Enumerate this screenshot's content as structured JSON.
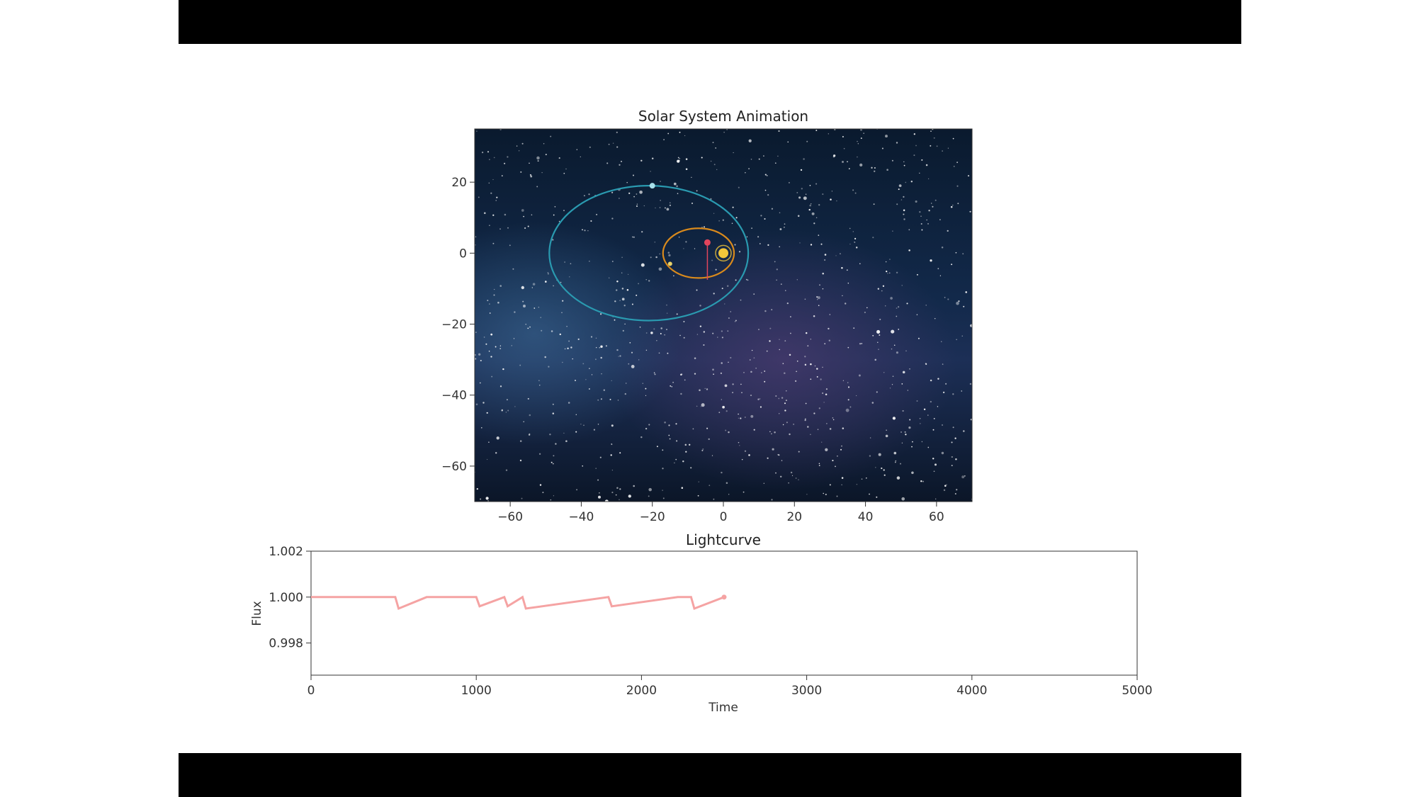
{
  "colors": {
    "letterbox": "#000000",
    "sky_top": "#0b1d33",
    "sky_band": "#3a2f5a",
    "outer_orbit": "#2a9ab0",
    "inner_orbit": "#d98a1c",
    "inner_planet": "#e0455c",
    "star": "#f2c63a",
    "flux_line": "#f5a3a3"
  },
  "chart_data": [
    {
      "type": "scatter",
      "title": "Solar System Animation",
      "xlim": [
        -70,
        70
      ],
      "ylim": [
        -70,
        35
      ],
      "x_ticks": [
        -60,
        -40,
        -20,
        0,
        20,
        40,
        60
      ],
      "x_tick_labels": [
        "−60",
        "−40",
        "−20",
        "0",
        "20",
        "40",
        "60"
      ],
      "y_ticks": [
        20,
        0,
        -20,
        -40,
        -60
      ],
      "y_tick_labels": [
        "20",
        "0",
        "−20",
        "−40",
        "−60"
      ],
      "background": "starfield image",
      "orbits": [
        {
          "center": [
            -21,
            0
          ],
          "semi_axes": [
            28,
            19
          ],
          "color": "outer_orbit"
        },
        {
          "center": [
            -7,
            0
          ],
          "semi_axes": [
            10,
            7
          ],
          "color": "inner_orbit"
        }
      ],
      "bodies": [
        {
          "x": 0,
          "y": 0,
          "kind": "star"
        },
        {
          "x": -20,
          "y": 19,
          "kind": "outer_planet"
        },
        {
          "x": -4.5,
          "y": 3,
          "kind": "inner_planet"
        },
        {
          "x": -15,
          "y": -3,
          "kind": "small_planet"
        }
      ]
    },
    {
      "type": "line",
      "title": "Lightcurve",
      "xlabel": "Time",
      "ylabel": "Flux",
      "xlim": [
        0,
        5000
      ],
      "ylim": [
        0.9966,
        1.002
      ],
      "x_ticks": [
        0,
        1000,
        2000,
        3000,
        4000,
        5000
      ],
      "x_tick_labels": [
        "0",
        "1000",
        "2000",
        "3000",
        "4000",
        "5000"
      ],
      "y_ticks": [
        1.002,
        1.0,
        0.998
      ],
      "y_tick_labels": [
        "1.002",
        "1.000",
        "0.998"
      ],
      "series": [
        {
          "x": [
            0,
            150,
            300,
            510,
            530,
            700,
            1000,
            1020,
            1170,
            1190,
            1280,
            1300,
            1800,
            1820,
            2220,
            2300,
            2320,
            2500
          ],
          "y": [
            1.0,
            1.0,
            1.0,
            1.0,
            0.9995,
            1.0,
            1.0,
            0.9996,
            1.0,
            0.9996,
            1.0,
            0.9995,
            1.0,
            0.9996,
            1.0,
            1.0,
            0.9995,
            1.0
          ]
        }
      ]
    }
  ]
}
